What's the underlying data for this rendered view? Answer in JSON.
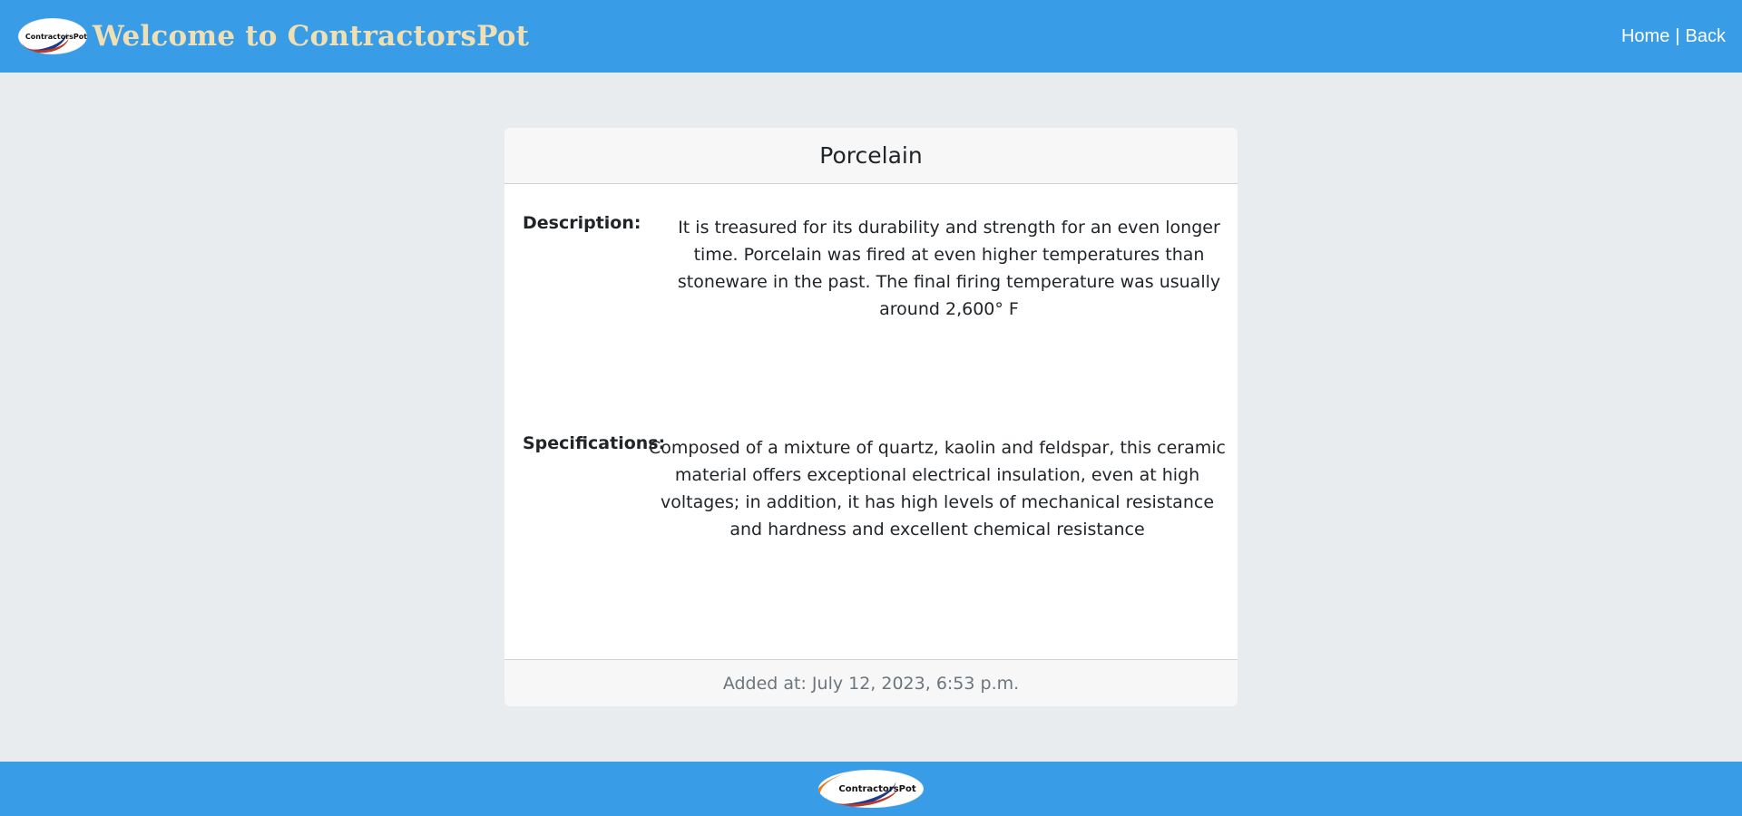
{
  "header": {
    "logo_text": "ContractorsPot",
    "title": "Welcome to ContractorsPot",
    "nav": {
      "home": "Home",
      "separator": "|",
      "back": "Back"
    }
  },
  "material": {
    "name": "Porcelain",
    "description_label": "Description:",
    "description": "It is treasured for its durability and strength for an even longer time. Porcelain was fired at even higher temperatures than stoneware in the past. The final firing temperature was usually around 2,600° F",
    "specifications_label": "Specifications:",
    "specifications": "Composed of a mixture of quartz, kaolin and feldspar, this ceramic material offers exceptional electrical insulation, even at high voltages; in addition, it has high levels of mechanical resistance and hardness and excellent chemical resistance",
    "added_at": "Added at: July 12, 2023, 6:53 p.m."
  },
  "footer": {
    "logo_text": "ContractorsPot"
  },
  "colors": {
    "navbar": "#389ce6",
    "brand_title": "#f1dfb4",
    "page_background": "#e8ecef",
    "card_header": "#f7f7f7"
  }
}
